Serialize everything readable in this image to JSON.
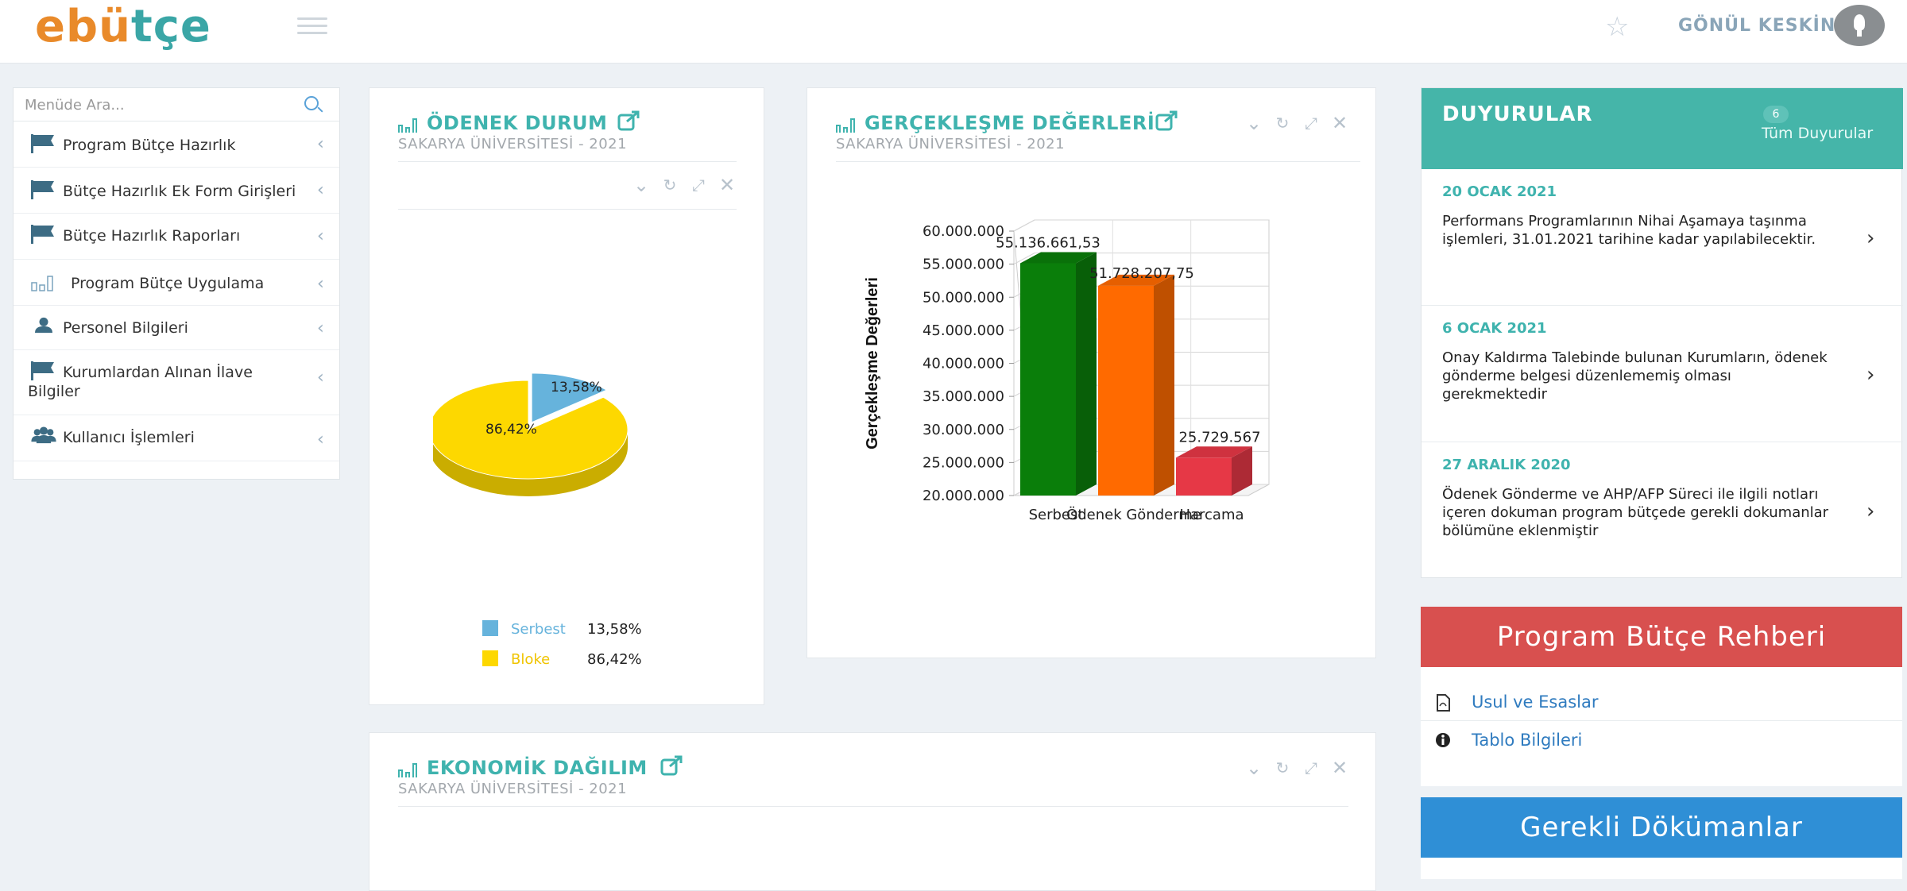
{
  "header": {
    "logo_part1": "ebü",
    "logo_part2": "tçe",
    "username": "GÖNÜL KESKİN"
  },
  "sidebar": {
    "search_placeholder": "Menüde Ara...",
    "items": [
      {
        "label": "Program Bütçe Hazırlık",
        "icon": "flag-icon"
      },
      {
        "label": "Bütçe Hazırlık Ek Form Girişleri",
        "icon": "flag-icon"
      },
      {
        "label": "Bütçe Hazırlık Raporları",
        "icon": "flag-icon"
      },
      {
        "label": "Program Bütçe Uygulama",
        "icon": "bar-chart-icon"
      },
      {
        "label": "Personel Bilgileri",
        "icon": "user-icon"
      },
      {
        "label": "Kurumlardan Alınan İlave",
        "label2": "Bilgiler",
        "icon": "flag-icon"
      },
      {
        "label": "Kullanıcı İşlemleri",
        "icon": "users-icon"
      }
    ]
  },
  "widgets": {
    "odenek": {
      "title": "ÖDENEK DURUM",
      "subtitle": "SAKARYA ÜNİVERSİTESİ - 2021"
    },
    "gerceklesme": {
      "title": "GERÇEKLEŞME DEĞERLERİ",
      "subtitle": "SAKARYA ÜNİVERSİTESİ - 2021"
    },
    "ekonomik": {
      "title": "EKONOMİK DAĞILIM",
      "subtitle": "SAKARYA ÜNİVERSİTESİ - 2021"
    }
  },
  "chart_data": [
    {
      "type": "pie",
      "categories": [
        "Serbest",
        "Bloke"
      ],
      "values": [
        13.58,
        86.42
      ],
      "value_labels": [
        "13,58%",
        "86,42%"
      ],
      "colors": [
        "#66b3dc",
        "#fdd800"
      ],
      "legend_position": "bottom"
    },
    {
      "type": "bar",
      "categories": [
        "Serbest",
        "Ödenek Gönderme",
        "Harcama"
      ],
      "values": [
        55136661.53,
        51728207.75,
        25729567
      ],
      "value_labels": [
        "55.136.661,53",
        "51.728.207,75",
        "25.729.567"
      ],
      "ylabel": "Gerçekleşme Değerleri",
      "ylim": [
        20000000,
        60000000
      ],
      "yticks": [
        "20.000.000",
        "25.000.000",
        "30.000.000",
        "35.000.000",
        "40.000.000",
        "45.000.000",
        "50.000.000",
        "55.000.000",
        "60.000.000"
      ],
      "colors": [
        "#0a7e0a",
        "#ff6a00",
        "#e63846"
      ],
      "grid": true
    }
  ],
  "announcements": {
    "title": "DUYURULAR",
    "badge": "6",
    "all_link": "Tüm Duyurular",
    "items": [
      {
        "date": "20 OCAK 2021",
        "text": "Performans Programlarının Nihai Aşamaya taşınma işlemleri, 31.01.2021 tarihine kadar yapılabilecektir."
      },
      {
        "date": "6 OCAK 2021",
        "text": "Onay Kaldırma Talebinde bulunan Kurumların, ödenek gönderme belgesi düzenlememiş olması gerekmektedir"
      },
      {
        "date": "27 ARALIK 2020",
        "text": "Ödenek Gönderme ve AHP/AFP Süreci ile ilgili notları içeren dokuman program bütçede gerekli dokumanlar bölümüne eklenmiştir"
      }
    ]
  },
  "rehber": {
    "title": "Program Bütçe Rehberi",
    "links": [
      "Usul ve Esaslar",
      "Tablo Bilgileri"
    ]
  },
  "gerekli": {
    "title": "Gerekli Dökümanlar"
  }
}
